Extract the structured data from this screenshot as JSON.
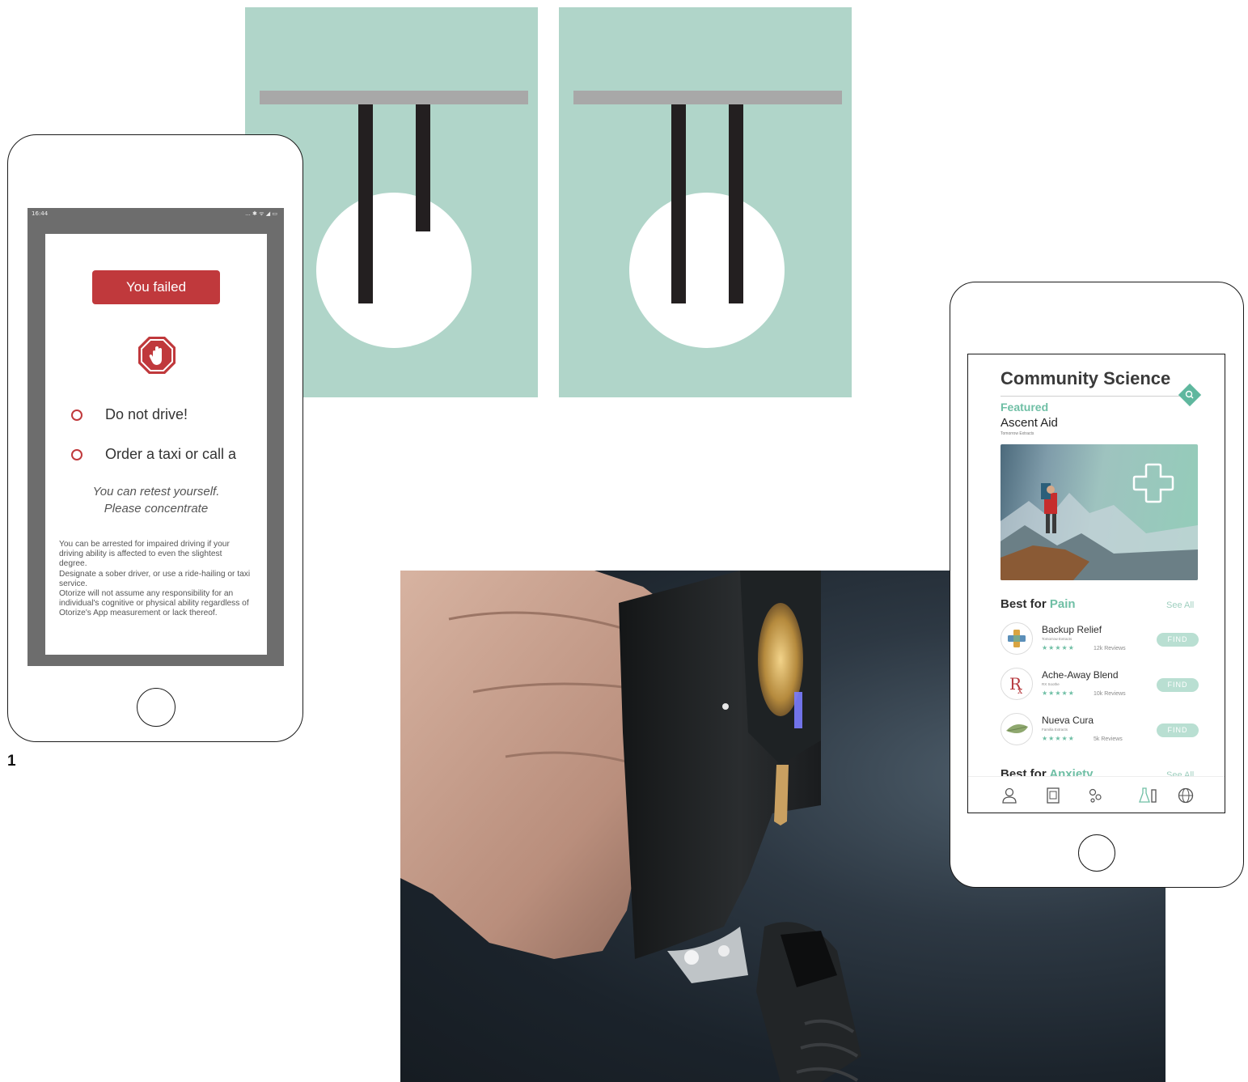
{
  "figure_label": "1",
  "phone_left": {
    "status_time": "16:44",
    "status_icons": "... ✱ ᯤ ◢ ▭",
    "fail_button": "You failed",
    "stop_icon": "stop-hand-icon",
    "options": [
      "Do not drive!",
      "Order a taxi or call a"
    ],
    "retest_line1": "You can retest yourself.",
    "retest_line2": "Please concentrate",
    "disclaimer": "You can be arrested for impaired driving if your driving ability is affected to even the slightest degree.\nDesignate a sober driver, or use a ride-hailing or taxi service.\nOtorize will not assume any responsibility for an individual's cognitive or physical ability regardless of Otorize's App measurement or lack thereof.",
    "accent_color": "#c0393c"
  },
  "phone_right": {
    "title": "Community Science",
    "search_icon": "search-icon",
    "featured_label": "Featured",
    "featured_title": "Ascent Aid",
    "featured_brand": "Tomorrow Extracts",
    "section1_prefix": "Best for",
    "section1_highlight": "Pain",
    "see_all": "See All",
    "products": [
      {
        "name": "Backup Relief",
        "brand": "Tomorrow Extracts",
        "stars": "★★★★★",
        "reviews": "12k Reviews",
        "action": "FIND",
        "icon": "cross-icon"
      },
      {
        "name": "Ache-Away Blend",
        "brand": "RX Soothe",
        "stars": "★★★★★",
        "reviews": "10k Reviews",
        "action": "FIND",
        "icon": "rx-icon"
      },
      {
        "name": "Nueva Cura",
        "brand": "Familia Extracts",
        "stars": "★★★★★",
        "reviews": "5k Reviews",
        "action": "FIND",
        "icon": "leaf-icon"
      }
    ],
    "section2_prefix": "Best for",
    "section2_highlight": "Anxiety",
    "section2_see_all": "See All",
    "nav_icons": [
      "user-icon",
      "document-icon",
      "connections-icon",
      "lab-icon",
      "globe-icon"
    ],
    "accent_color": "#6fbfa5"
  },
  "panels": {
    "background": "#b0d5c9",
    "bar_color": "#a8a8a8",
    "rod_color": "#231f20"
  }
}
